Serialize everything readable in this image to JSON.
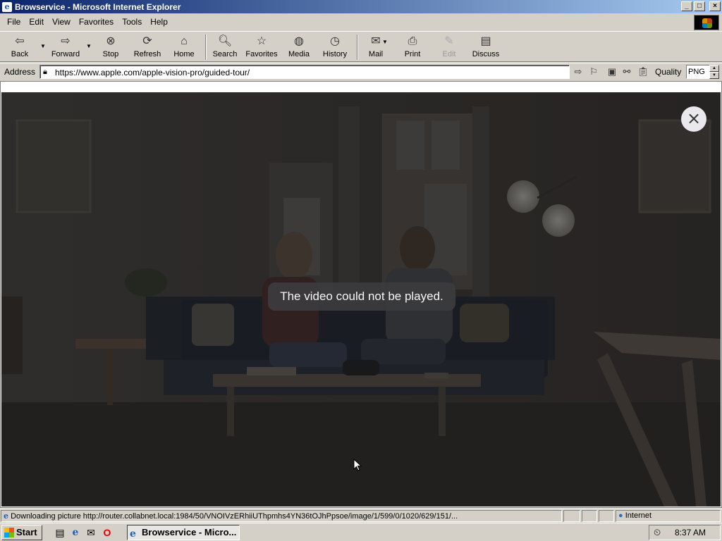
{
  "window": {
    "title": "Browservice - Microsoft Internet Explorer",
    "controls": {
      "minimize": "_",
      "maximize": "□",
      "close": "×"
    }
  },
  "menu": [
    "File",
    "Edit",
    "View",
    "Favorites",
    "Tools",
    "Help"
  ],
  "toolbar": {
    "back": "Back",
    "forward": "Forward",
    "stop": "Stop",
    "refresh": "Refresh",
    "home": "Home",
    "search": "Search",
    "favorites": "Favorites",
    "media": "Media",
    "history": "History",
    "mail": "Mail",
    "print": "Print",
    "edit": "Edit",
    "discuss": "Discuss"
  },
  "address": {
    "label": "Address",
    "url": "https://www.apple.com/apple-vision-pro/guided-tour/",
    "quality_label": "Quality",
    "quality_value": "PNG"
  },
  "content": {
    "error_message": "The video could not be played.",
    "close_glyph": "×"
  },
  "status": {
    "text": "Downloading picture http://router.collabnet.local:1984/50/VNOIVzERhiiUThpmhs4YN36tOJhPpsoe/image/1/599/0/1020/629/151/...",
    "zone": "Internet"
  },
  "taskbar": {
    "start": "Start",
    "task": "Browservice - Micro...",
    "clock": "8:37 AM"
  },
  "icons": {
    "back": "back-arrow-icon",
    "forward": "forward-arrow-icon",
    "stop": "stop-icon",
    "refresh": "refresh-icon",
    "home": "home-icon",
    "search": "search-icon",
    "favorites": "favorites-folder-icon",
    "media": "media-icon",
    "history": "history-icon",
    "mail": "mail-icon",
    "print": "printer-icon",
    "edit": "edit-icon",
    "discuss": "discuss-icon"
  }
}
